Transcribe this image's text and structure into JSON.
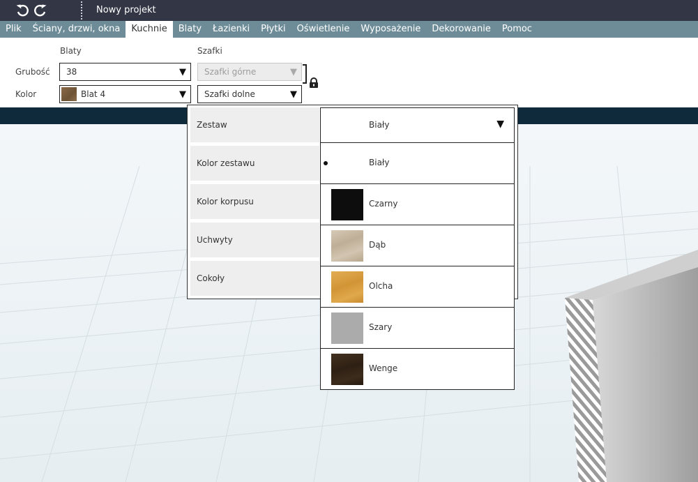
{
  "titlebar": {
    "undo_icon": "undo-icon",
    "redo_icon": "redo-icon",
    "project_title": "Nowy projekt"
  },
  "menu": {
    "items": [
      "Plik",
      "Ściany, drzwi, okna",
      "Kuchnie",
      "Blaty",
      "Łazienki",
      "Płytki",
      "Oświetlenie",
      "Wyposażenie",
      "Dekorowanie",
      "Pomoc"
    ],
    "active": "Kuchnie"
  },
  "toolbar": {
    "blaty_heading": "Blaty",
    "szafki_heading": "Szafki",
    "grubosc_label": "Grubość",
    "kolor_label": "Kolor",
    "grubosc_value": "38",
    "kolor_value": "Blat 4",
    "szafki_gorne": "Szafki górne",
    "szafki_dolne": "Szafki dolne",
    "lock_icon": "lock-icon"
  },
  "panel": {
    "rows": [
      "Zestaw",
      "Kolor zestawu",
      "Kolor korpusu",
      "Uchwyty",
      "Cokoły"
    ],
    "zestaw_value": "Biały",
    "options": [
      {
        "label": "Biały",
        "color": "#ffffff",
        "selected": true
      },
      {
        "label": "Czarny",
        "color": "#0d0d0d",
        "selected": false
      },
      {
        "label": "Dąb",
        "color": "#c9bba6",
        "selected": false
      },
      {
        "label": "Olcha",
        "color": "#d9a046",
        "selected": false
      },
      {
        "label": "Szary",
        "color": "#ababab",
        "selected": false
      },
      {
        "label": "Wenge",
        "color": "#3a2a1e",
        "selected": false
      }
    ]
  },
  "colors": {
    "titlebar_bg": "#333745",
    "menubar_bg": "#6d8c98",
    "strip_bg": "#0f2a3a"
  }
}
